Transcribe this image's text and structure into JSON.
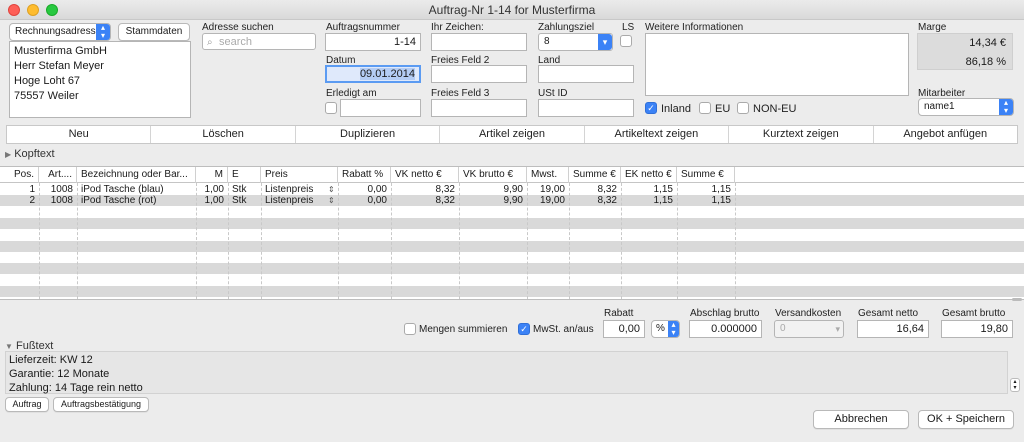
{
  "window": {
    "title": "Auftrag-Nr 1-14 for Musterfirma"
  },
  "address": {
    "type_select": "Rechnungsadresse",
    "stammdaten_btn": "Stammdaten",
    "lines": [
      "Musterfirma GmbH",
      "Herr Stefan Meyer",
      "Hoge Loht 67",
      "75557 Weiler"
    ],
    "search_label": "Adresse suchen",
    "search_placeholder": "search"
  },
  "order": {
    "auftragsnummer_label": "Auftragsnummer",
    "auftragsnummer": "1-14",
    "datum_label": "Datum",
    "datum": "09.01.2014",
    "erledigt_label": "Erledigt am",
    "ihr_zeichen_label": "Ihr Zeichen:",
    "freies2_label": "Freies Feld 2",
    "freies3_label": "Freies Feld 3",
    "zahlungsziel_label": "Zahlungsziel",
    "zahlungsziel": "8",
    "ls_label": "LS",
    "land_label": "Land",
    "ustid_label": "USt ID",
    "weitere_label": "Weitere Informationen",
    "inland_label": "Inland",
    "eu_label": "EU",
    "noneu_label": "NON-EU",
    "marge_label": "Marge",
    "marge_value": "14,34 €",
    "marge_percent": "86,18 %",
    "mitarbeiter_label": "Mitarbeiter",
    "mitarbeiter": "name1"
  },
  "actions": [
    "Neu",
    "Löschen",
    "Duplizieren",
    "Artikel zeigen",
    "Artikeltext zeigen",
    "Kurztext zeigen",
    "Angebot anfügen"
  ],
  "kopftext_label": "Kopftext",
  "table": {
    "columns": [
      "Pos.",
      "Art....",
      "Bezeichnung oder Bar...",
      "M",
      "E",
      "Preis",
      "Rabatt %",
      "VK netto €",
      "VK brutto €",
      "Mwst.",
      "Summe €",
      "EK netto €",
      "Summe €"
    ],
    "rows": [
      [
        "1",
        "1008",
        "iPod Tasche  (blau)",
        "1,00",
        "Stk",
        "Listenpreis",
        "0,00",
        "8,32",
        "9,90",
        "19,00",
        "8,32",
        "1,15",
        "1,15"
      ],
      [
        "2",
        "1008",
        "iPod Tasche  (rot)",
        "1,00",
        "Stk",
        "Listenpreis",
        "0,00",
        "8,32",
        "9,90",
        "19,00",
        "8,32",
        "1,15",
        "1,15"
      ]
    ]
  },
  "totals": {
    "mengen_label": "Mengen summieren",
    "mwst_label": "MwSt. an/aus",
    "rabatt_label": "Rabatt",
    "rabatt_value": "0,00",
    "rabatt_unit": "%",
    "abschlag_label": "Abschlag brutto",
    "abschlag_value": "0.000000",
    "versand_label": "Versandkosten",
    "versand_value": "0",
    "netto_label": "Gesamt netto",
    "netto_value": "16,64",
    "brutto_label": "Gesamt brutto",
    "brutto_value": "19,80"
  },
  "fusstext": {
    "label": "Fußtext",
    "lines": [
      "Lieferzeit: KW 12",
      "Garantie: 12 Monate",
      "Zahlung: 14 Tage rein netto"
    ]
  },
  "bottom": {
    "auftrag_btn": "Auftrag",
    "bestaetigung_btn": "Auftragsbestätigung",
    "cancel_btn": "Abbrechen",
    "save_btn": "OK + Speichern"
  }
}
